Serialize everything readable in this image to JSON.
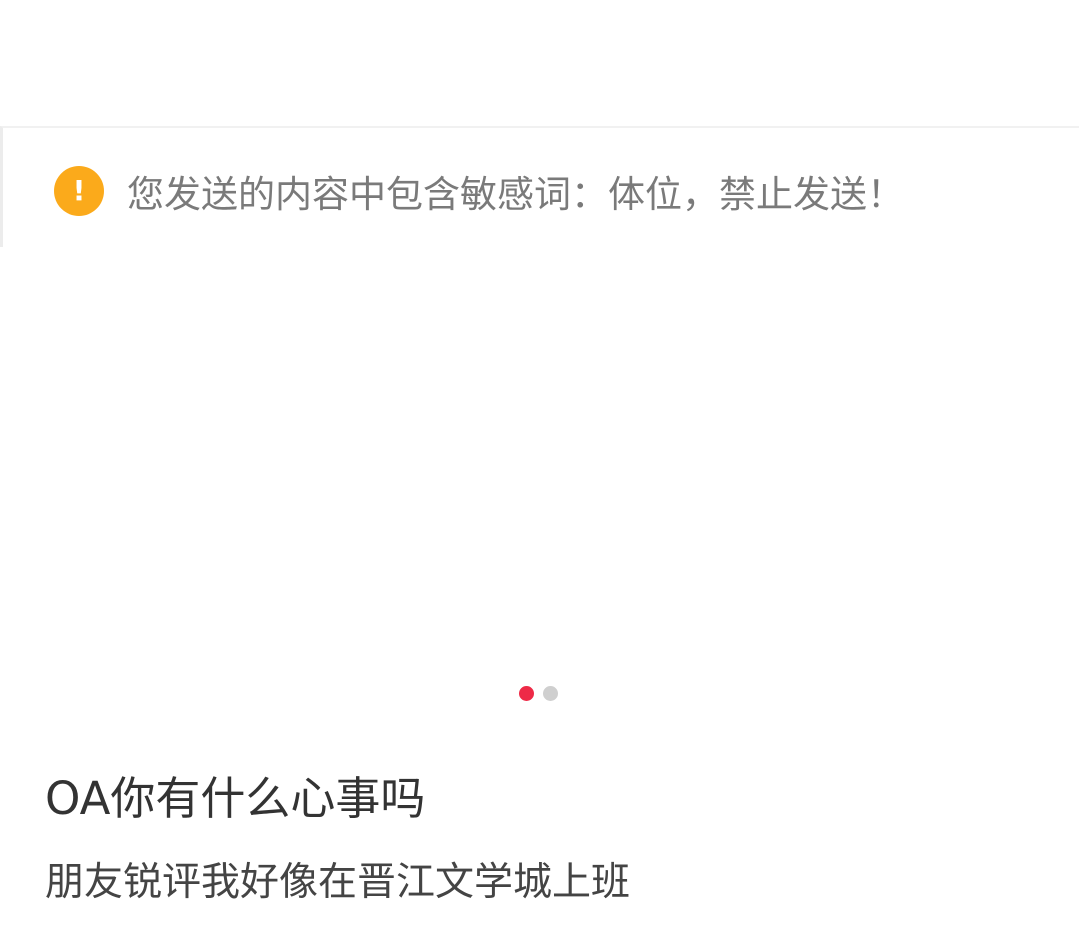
{
  "toast": {
    "icon": "exclamation-circle-icon",
    "icon_glyph": "!",
    "message": "您发送的内容中包含敏感词：体位，禁止发送！",
    "icon_color": "#fbaa1b"
  },
  "carousel": {
    "active_index": 0,
    "total": 2,
    "active_color": "#ee2a47",
    "inactive_color": "#cfcfcf"
  },
  "post": {
    "title": "OA你有什么心事吗",
    "subtitle": "朋友锐评我好像在晋江文学城上班"
  }
}
